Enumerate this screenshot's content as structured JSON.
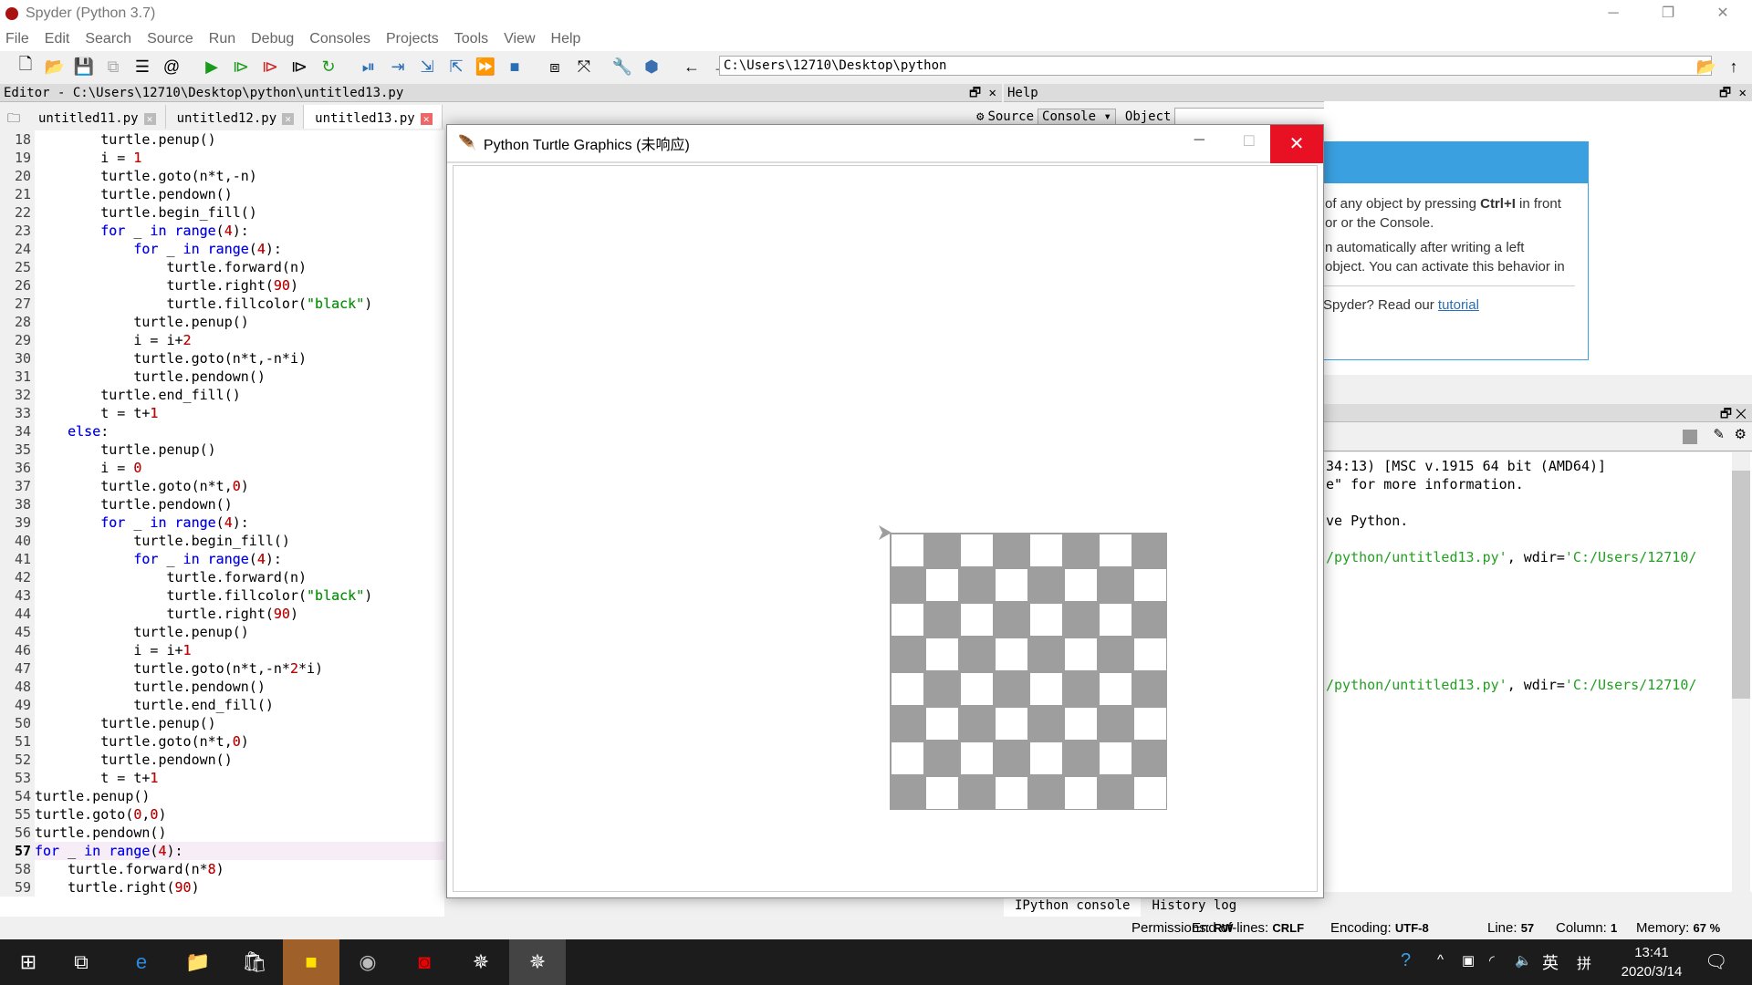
{
  "window": {
    "title": "Spyder (Python 3.7)"
  },
  "menu": [
    "File",
    "Edit",
    "Search",
    "Source",
    "Run",
    "Debug",
    "Consoles",
    "Projects",
    "Tools",
    "View",
    "Help"
  ],
  "toolbar": {
    "path": "C:\\Users\\12710\\Desktop\\python"
  },
  "editor": {
    "header": "Editor - C:\\Users\\12710\\Desktop\\python\\untitled13.py",
    "tabs": [
      {
        "label": "untitled11.py"
      },
      {
        "label": "untitled12.py"
      },
      {
        "label": "untitled13.py",
        "active": true
      }
    ],
    "current_line": 57,
    "lines": [
      {
        "n": 18,
        "t": "        turtle.penup()"
      },
      {
        "n": 19,
        "t": "        i = 1"
      },
      {
        "n": 20,
        "t": "        turtle.goto(n*t,-n)"
      },
      {
        "n": 21,
        "t": "        turtle.pendown()"
      },
      {
        "n": 22,
        "t": "        turtle.begin_fill()"
      },
      {
        "n": 23,
        "t": "        for _ in range(4):"
      },
      {
        "n": 24,
        "t": "            for _ in range(4):"
      },
      {
        "n": 25,
        "t": "                turtle.forward(n)"
      },
      {
        "n": 26,
        "t": "                turtle.right(90)"
      },
      {
        "n": 27,
        "t": "                turtle.fillcolor(\"black\")"
      },
      {
        "n": 28,
        "t": "            turtle.penup()"
      },
      {
        "n": 29,
        "t": "            i = i+2"
      },
      {
        "n": 30,
        "t": "            turtle.goto(n*t,-n*i)"
      },
      {
        "n": 31,
        "t": "            turtle.pendown()"
      },
      {
        "n": 32,
        "t": "        turtle.end_fill()"
      },
      {
        "n": 33,
        "t": "        t = t+1"
      },
      {
        "n": 34,
        "t": "    else:"
      },
      {
        "n": 35,
        "t": "        turtle.penup()"
      },
      {
        "n": 36,
        "t": "        i = 0"
      },
      {
        "n": 37,
        "t": "        turtle.goto(n*t,0)"
      },
      {
        "n": 38,
        "t": "        turtle.pendown()"
      },
      {
        "n": 39,
        "t": "        for _ in range(4):"
      },
      {
        "n": 40,
        "t": "            turtle.begin_fill()"
      },
      {
        "n": 41,
        "t": "            for _ in range(4):"
      },
      {
        "n": 42,
        "t": "                turtle.forward(n)"
      },
      {
        "n": 43,
        "t": "                turtle.fillcolor(\"black\")"
      },
      {
        "n": 44,
        "t": "                turtle.right(90)"
      },
      {
        "n": 45,
        "t": "            turtle.penup()"
      },
      {
        "n": 46,
        "t": "            i = i+1"
      },
      {
        "n": 47,
        "t": "            turtle.goto(n*t,-n*2*i)"
      },
      {
        "n": 48,
        "t": "            turtle.pendown()"
      },
      {
        "n": 49,
        "t": "            turtle.end_fill()"
      },
      {
        "n": 50,
        "t": "        turtle.penup()"
      },
      {
        "n": 51,
        "t": "        turtle.goto(n*t,0)"
      },
      {
        "n": 52,
        "t": "        turtle.pendown()"
      },
      {
        "n": 53,
        "t": "        t = t+1"
      },
      {
        "n": 54,
        "t": "turtle.penup()"
      },
      {
        "n": 55,
        "t": "turtle.goto(0,0)"
      },
      {
        "n": 56,
        "t": "turtle.pendown()"
      },
      {
        "n": 57,
        "t": "for _ in range(4):"
      },
      {
        "n": 58,
        "t": "    turtle.forward(n*8)"
      },
      {
        "n": 59,
        "t": "    turtle.right(90)"
      }
    ]
  },
  "turtle": {
    "title": "Python Turtle Graphics (未响应)",
    "board_size": 8,
    "colors": {
      "dark": "#9e9e9e",
      "light": "#ffffff"
    }
  },
  "help": {
    "header": "Help",
    "source_label": "Source",
    "source_value": "Console",
    "object_label": "Object",
    "lines": [
      {
        "pre": "of any object by pressing ",
        "bold": "Ctrl+I",
        "post": " in front"
      },
      {
        "pre": "or or the Console."
      },
      {
        "pre": "n automatically after writing a left"
      },
      {
        "pre": "object. You can activate this behavior in"
      }
    ],
    "tutorial_pre": "Spyder? Read our ",
    "tutorial_link": "tutorial"
  },
  "console": {
    "lines": [
      {
        "t": "34:13) [MSC v.1915 64 bit (AMD64)]"
      },
      {
        "t": "e\" for more information."
      },
      {
        "t": ""
      },
      {
        "t": "ve Python."
      },
      {
        "t": ""
      },
      {
        "g": "/python/untitled13.py'",
        "t": ", wdir=",
        "g2": "'C:/Users/12710/"
      },
      {
        "t": ""
      },
      {
        "t": ""
      },
      {
        "t": ""
      },
      {
        "t": ""
      },
      {
        "t": ""
      },
      {
        "t": ""
      },
      {
        "g": "/python/untitled13.py'",
        "t": ", wdir=",
        "g2": "'C:/Users/12710/"
      }
    ],
    "tabs": [
      "IPython console",
      "History log"
    ]
  },
  "status": {
    "permissions_label": "Permissions:",
    "permissions": "RW",
    "eol_label": "End-of-lines:",
    "eol": "CRLF",
    "encoding_label": "Encoding:",
    "encoding": "UTF-8",
    "line_label": "Line:",
    "line": "57",
    "column_label": "Column:",
    "column": "1",
    "memory_label": "Memory:",
    "memory": "67 %"
  },
  "taskbar": {
    "time": "13:41",
    "date": "2020/3/14",
    "ime1": "英",
    "ime2": "拼"
  },
  "colors": {
    "accent": "#e81123",
    "help_blue": "#3aa0e0"
  }
}
